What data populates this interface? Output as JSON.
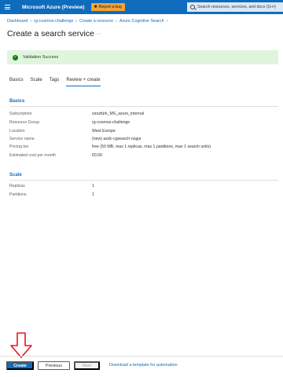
{
  "header": {
    "brand": "Microsoft Azure (Preview)",
    "report_bug": "Report a bug",
    "search_placeholder": "Search resources, services, and docs (G+/)"
  },
  "breadcrumb": [
    "Dashboard",
    "rg-cosmos-challenge",
    "Create a resource",
    "Azure Cognitive Search"
  ],
  "page": {
    "title": "Create a search service",
    "more": "···"
  },
  "validation": {
    "text": "Validation Success"
  },
  "tabs": [
    "Basics",
    "Scale",
    "Tags",
    "Review + create"
  ],
  "basics": {
    "heading": "Basics",
    "rows": [
      {
        "label": "Subscription",
        "value": "ozoztürk_MS_azure_internal"
      },
      {
        "label": "Resource Group",
        "value": "rg-cosmos-challenge"
      },
      {
        "label": "Location",
        "value": "West Europe"
      },
      {
        "label": "Service name",
        "value": "(new) azdc-cgsearch-ozgur"
      },
      {
        "label": "Pricing tier",
        "value": "free (50 MB, max 1 replicas, max 1 partitions, max 1 search units)"
      },
      {
        "label": "Estimated cost per month",
        "value": "€0.00"
      }
    ]
  },
  "scale": {
    "heading": "Scale",
    "rows": [
      {
        "label": "Replicas",
        "value": "1"
      },
      {
        "label": "Partitions",
        "value": "1"
      }
    ]
  },
  "footer": {
    "create": "Create",
    "previous": "Previous",
    "next": "Next",
    "template_link": "Download a template for automation"
  },
  "colors": {
    "accent": "#0f6cbd",
    "success_bg": "#dff6dd",
    "annotation": "#e81123"
  }
}
